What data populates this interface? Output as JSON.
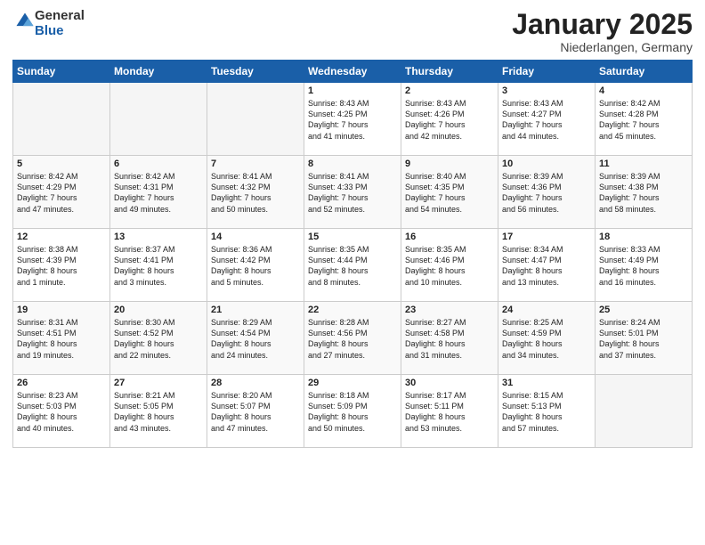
{
  "header": {
    "logo_general": "General",
    "logo_blue": "Blue",
    "title": "January 2025",
    "location": "Niederlangen, Germany"
  },
  "days_of_week": [
    "Sunday",
    "Monday",
    "Tuesday",
    "Wednesday",
    "Thursday",
    "Friday",
    "Saturday"
  ],
  "weeks": [
    [
      {
        "day": "",
        "info": ""
      },
      {
        "day": "",
        "info": ""
      },
      {
        "day": "",
        "info": ""
      },
      {
        "day": "1",
        "info": "Sunrise: 8:43 AM\nSunset: 4:25 PM\nDaylight: 7 hours\nand 41 minutes."
      },
      {
        "day": "2",
        "info": "Sunrise: 8:43 AM\nSunset: 4:26 PM\nDaylight: 7 hours\nand 42 minutes."
      },
      {
        "day": "3",
        "info": "Sunrise: 8:43 AM\nSunset: 4:27 PM\nDaylight: 7 hours\nand 44 minutes."
      },
      {
        "day": "4",
        "info": "Sunrise: 8:42 AM\nSunset: 4:28 PM\nDaylight: 7 hours\nand 45 minutes."
      }
    ],
    [
      {
        "day": "5",
        "info": "Sunrise: 8:42 AM\nSunset: 4:29 PM\nDaylight: 7 hours\nand 47 minutes."
      },
      {
        "day": "6",
        "info": "Sunrise: 8:42 AM\nSunset: 4:31 PM\nDaylight: 7 hours\nand 49 minutes."
      },
      {
        "day": "7",
        "info": "Sunrise: 8:41 AM\nSunset: 4:32 PM\nDaylight: 7 hours\nand 50 minutes."
      },
      {
        "day": "8",
        "info": "Sunrise: 8:41 AM\nSunset: 4:33 PM\nDaylight: 7 hours\nand 52 minutes."
      },
      {
        "day": "9",
        "info": "Sunrise: 8:40 AM\nSunset: 4:35 PM\nDaylight: 7 hours\nand 54 minutes."
      },
      {
        "day": "10",
        "info": "Sunrise: 8:39 AM\nSunset: 4:36 PM\nDaylight: 7 hours\nand 56 minutes."
      },
      {
        "day": "11",
        "info": "Sunrise: 8:39 AM\nSunset: 4:38 PM\nDaylight: 7 hours\nand 58 minutes."
      }
    ],
    [
      {
        "day": "12",
        "info": "Sunrise: 8:38 AM\nSunset: 4:39 PM\nDaylight: 8 hours\nand 1 minute."
      },
      {
        "day": "13",
        "info": "Sunrise: 8:37 AM\nSunset: 4:41 PM\nDaylight: 8 hours\nand 3 minutes."
      },
      {
        "day": "14",
        "info": "Sunrise: 8:36 AM\nSunset: 4:42 PM\nDaylight: 8 hours\nand 5 minutes."
      },
      {
        "day": "15",
        "info": "Sunrise: 8:35 AM\nSunset: 4:44 PM\nDaylight: 8 hours\nand 8 minutes."
      },
      {
        "day": "16",
        "info": "Sunrise: 8:35 AM\nSunset: 4:46 PM\nDaylight: 8 hours\nand 10 minutes."
      },
      {
        "day": "17",
        "info": "Sunrise: 8:34 AM\nSunset: 4:47 PM\nDaylight: 8 hours\nand 13 minutes."
      },
      {
        "day": "18",
        "info": "Sunrise: 8:33 AM\nSunset: 4:49 PM\nDaylight: 8 hours\nand 16 minutes."
      }
    ],
    [
      {
        "day": "19",
        "info": "Sunrise: 8:31 AM\nSunset: 4:51 PM\nDaylight: 8 hours\nand 19 minutes."
      },
      {
        "day": "20",
        "info": "Sunrise: 8:30 AM\nSunset: 4:52 PM\nDaylight: 8 hours\nand 22 minutes."
      },
      {
        "day": "21",
        "info": "Sunrise: 8:29 AM\nSunset: 4:54 PM\nDaylight: 8 hours\nand 24 minutes."
      },
      {
        "day": "22",
        "info": "Sunrise: 8:28 AM\nSunset: 4:56 PM\nDaylight: 8 hours\nand 27 minutes."
      },
      {
        "day": "23",
        "info": "Sunrise: 8:27 AM\nSunset: 4:58 PM\nDaylight: 8 hours\nand 31 minutes."
      },
      {
        "day": "24",
        "info": "Sunrise: 8:25 AM\nSunset: 4:59 PM\nDaylight: 8 hours\nand 34 minutes."
      },
      {
        "day": "25",
        "info": "Sunrise: 8:24 AM\nSunset: 5:01 PM\nDaylight: 8 hours\nand 37 minutes."
      }
    ],
    [
      {
        "day": "26",
        "info": "Sunrise: 8:23 AM\nSunset: 5:03 PM\nDaylight: 8 hours\nand 40 minutes."
      },
      {
        "day": "27",
        "info": "Sunrise: 8:21 AM\nSunset: 5:05 PM\nDaylight: 8 hours\nand 43 minutes."
      },
      {
        "day": "28",
        "info": "Sunrise: 8:20 AM\nSunset: 5:07 PM\nDaylight: 8 hours\nand 47 minutes."
      },
      {
        "day": "29",
        "info": "Sunrise: 8:18 AM\nSunset: 5:09 PM\nDaylight: 8 hours\nand 50 minutes."
      },
      {
        "day": "30",
        "info": "Sunrise: 8:17 AM\nSunset: 5:11 PM\nDaylight: 8 hours\nand 53 minutes."
      },
      {
        "day": "31",
        "info": "Sunrise: 8:15 AM\nSunset: 5:13 PM\nDaylight: 8 hours\nand 57 minutes."
      },
      {
        "day": "",
        "info": ""
      }
    ]
  ]
}
